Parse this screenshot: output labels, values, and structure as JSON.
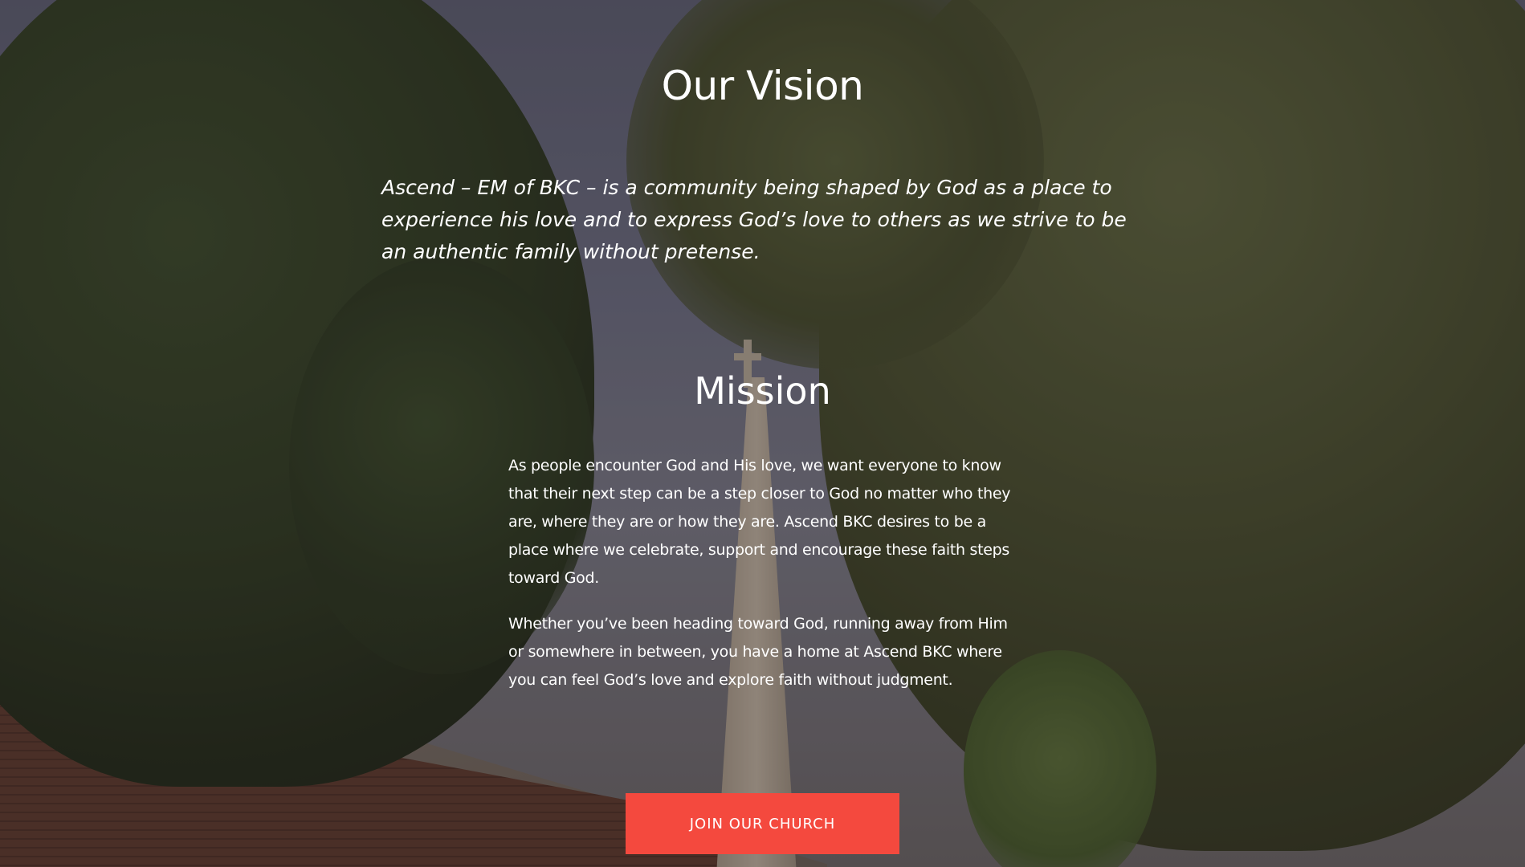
{
  "vision": {
    "title": "Our Vision",
    "statement": "Ascend – EM of BKC – is a community being shaped by God as a place to experience his love and to express God’s love to others as we strive to be an authentic family without pretense."
  },
  "mission": {
    "title": "Mission",
    "paragraphs": [
      "As people encounter God and His love, we want everyone to know that their next step can be a step closer to God no matter who they are, where they are or how they are. Ascend BKC desires to be a place where we celebrate, support and encourage these faith steps toward God.",
      "Whether you’ve been heading toward God, running away from Him or somewhere in between, you have a home at Ascend BKC where you can feel God’s love and explore faith without judgment."
    ]
  },
  "cta": {
    "join_label": "JOIN OUR CHURCH"
  },
  "colors": {
    "button": "#f4493e",
    "text": "#ffffff"
  }
}
